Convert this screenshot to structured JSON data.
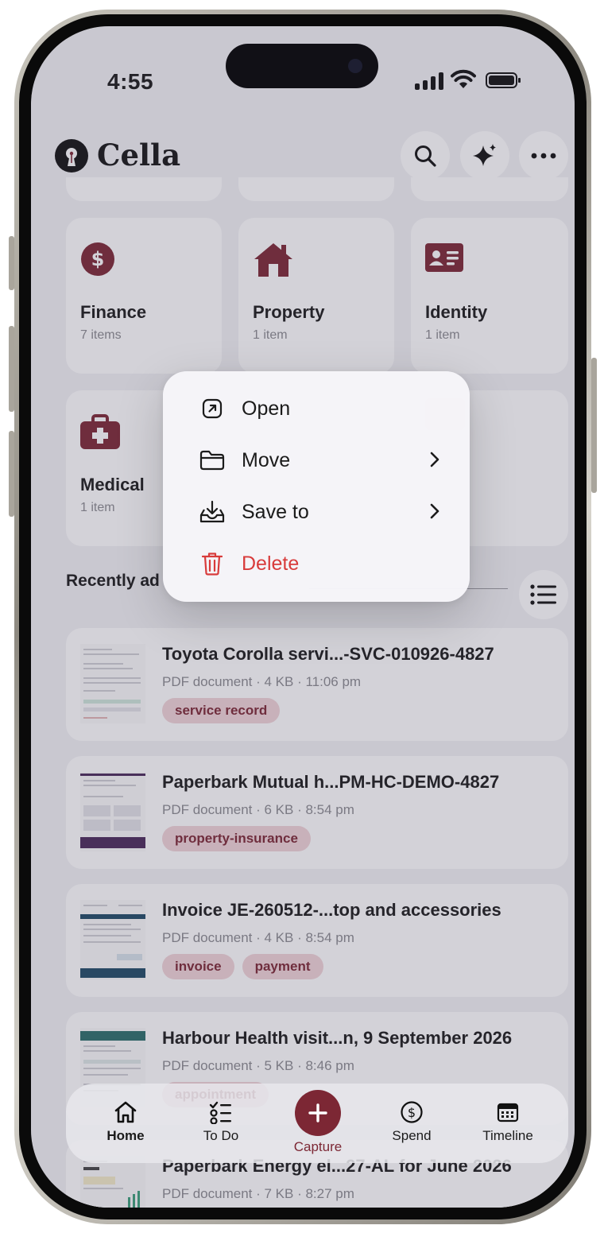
{
  "status_bar": {
    "time": "4:55"
  },
  "header": {
    "app_name": "Cella"
  },
  "categories": [
    {
      "name": "Finance",
      "count": "7 items",
      "icon": "dollar-circle-icon"
    },
    {
      "name": "Property",
      "count": "1 item",
      "icon": "house-icon"
    },
    {
      "name": "Identity",
      "count": "1 item",
      "icon": "id-card-icon"
    },
    {
      "name": "Medical",
      "count": "1 item",
      "icon": "medical-kit-icon"
    }
  ],
  "recent": {
    "title": "Recently ad",
    "documents": [
      {
        "title": "Toyota Corolla servi...-SVC-010926-4827",
        "meta": "PDF document · 4 KB · 11:06 pm",
        "tags": [
          "service record"
        ]
      },
      {
        "title": "Paperbark Mutual h...PM-HC-DEMO-4827",
        "meta": "PDF document · 6 KB · 8:54 pm",
        "tags": [
          "property-insurance"
        ]
      },
      {
        "title": "Invoice JE-260512-...top and accessories",
        "meta": "PDF document · 4 KB · 8:54 pm",
        "tags": [
          "invoice",
          "payment"
        ]
      },
      {
        "title": "Harbour Health visit...n, 9 September 2026",
        "meta": "PDF document · 5 KB · 8:46 pm",
        "tags": [
          "appointment"
        ]
      },
      {
        "title": "Paperbark Energy el...27-AL for June 2026",
        "meta": "PDF document · 7 KB · 8:27 pm",
        "tags": []
      }
    ]
  },
  "context_menu": {
    "open": "Open",
    "move": "Move",
    "save_to": "Save to",
    "delete": "Delete"
  },
  "tab_bar": {
    "home": "Home",
    "todo": "To Do",
    "capture": "Capture",
    "spend": "Spend",
    "timeline": "Timeline"
  },
  "colors": {
    "accent": "#7c2734",
    "danger": "#d83b3b",
    "tag_bg": "#f1d4d8"
  }
}
